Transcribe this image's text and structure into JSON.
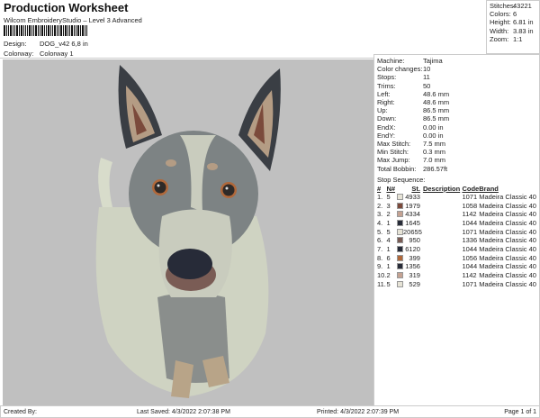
{
  "header": {
    "title": "Production Worksheet",
    "subtitle": "Wilcom EmbroideryStudio – Level 3 Advanced",
    "design_label": "Design:",
    "design_value": "DOG_v42 6,8 in",
    "colorway_label": "Colorway:",
    "colorway_value": "Colorway 1"
  },
  "stats": [
    {
      "k": "Stitches:",
      "v": "43221"
    },
    {
      "k": "Colors:",
      "v": "6"
    },
    {
      "k": "Height:",
      "v": "6.81 in"
    },
    {
      "k": "Width:",
      "v": "3.83 in"
    },
    {
      "k": "Zoom:",
      "v": "1:1"
    }
  ],
  "info": [
    {
      "k": "Machine:",
      "v": "Tajima"
    },
    {
      "k": "Color changes:",
      "v": "10"
    },
    {
      "k": "Stops:",
      "v": "11"
    },
    {
      "k": "Trims:",
      "v": "50"
    },
    {
      "k": "Left:",
      "v": "48.6 mm"
    },
    {
      "k": "Right:",
      "v": "48.6 mm"
    },
    {
      "k": "Up:",
      "v": "86.5 mm"
    },
    {
      "k": "Down:",
      "v": "86.5 mm"
    },
    {
      "k": "EndX:",
      "v": "0.00 in"
    },
    {
      "k": "EndY:",
      "v": "0.00 in"
    },
    {
      "k": "Max Stitch:",
      "v": "7.5 mm"
    },
    {
      "k": "Min Stitch:",
      "v": "0.3 mm"
    },
    {
      "k": "Max Jump:",
      "v": "7.0 mm"
    },
    {
      "k": "Total Bobbin:",
      "v": "286.57ft"
    }
  ],
  "sequence": {
    "title": "Stop Sequence:",
    "headers": [
      "#",
      "N#",
      "St.",
      "Description",
      "Code",
      "Brand"
    ],
    "rows": [
      {
        "i": "1.",
        "n": "5",
        "color": "#e6e3d6",
        "st": "4933",
        "desc": "",
        "code": "1071",
        "brand": "Madeira Classic 40"
      },
      {
        "i": "2.",
        "n": "3",
        "color": "#7b4a3b",
        "st": "1979",
        "desc": "",
        "code": "1058",
        "brand": "Madeira Classic 40"
      },
      {
        "i": "3.",
        "n": "2",
        "color": "#c4a292",
        "st": "4334",
        "desc": "",
        "code": "1142",
        "brand": "Madeira Classic 40"
      },
      {
        "i": "4.",
        "n": "1",
        "color": "#272b38",
        "st": "1645",
        "desc": "",
        "code": "1044",
        "brand": "Madeira Classic 40"
      },
      {
        "i": "5.",
        "n": "5",
        "color": "#e6e3d6",
        "st": "20655",
        "desc": "",
        "code": "1071",
        "brand": "Madeira Classic 40"
      },
      {
        "i": "6.",
        "n": "4",
        "color": "#7a5c55",
        "st": "950",
        "desc": "",
        "code": "1336",
        "brand": "Madeira Classic 40"
      },
      {
        "i": "7.",
        "n": "1",
        "color": "#272b38",
        "st": "6120",
        "desc": "",
        "code": "1044",
        "brand": "Madeira Classic 40"
      },
      {
        "i": "8.",
        "n": "6",
        "color": "#b0683a",
        "st": "399",
        "desc": "",
        "code": "1056",
        "brand": "Madeira Classic 40"
      },
      {
        "i": "9.",
        "n": "1",
        "color": "#272b38",
        "st": "1356",
        "desc": "",
        "code": "1044",
        "brand": "Madeira Classic 40"
      },
      {
        "i": "10.",
        "n": "2",
        "color": "#c4a292",
        "st": "319",
        "desc": "",
        "code": "1142",
        "brand": "Madeira Classic 40"
      },
      {
        "i": "11.",
        "n": "5",
        "color": "#e6e3d6",
        "st": "529",
        "desc": "",
        "code": "1071",
        "brand": "Madeira Classic 40"
      }
    ]
  },
  "footer": {
    "created": "Created By:",
    "saved": "Last Saved: 4/3/2022 2:07:38 PM",
    "printed": "Printed: 4/3/2022 2:07:39 PM",
    "page": "Page 1 of 1"
  }
}
